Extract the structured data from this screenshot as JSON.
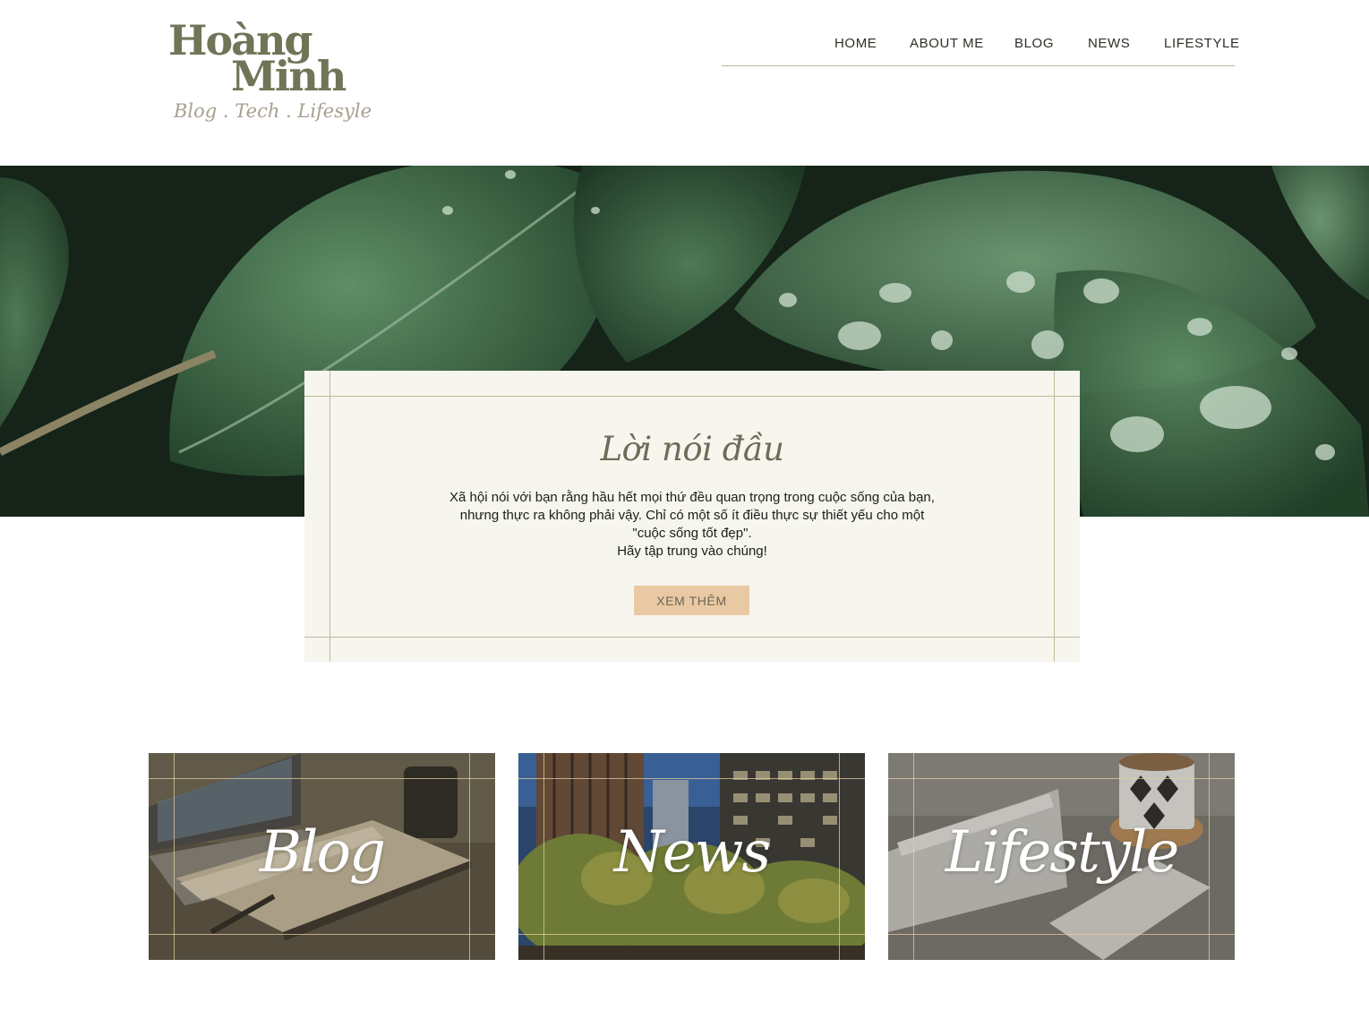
{
  "header": {
    "logo": {
      "line1": "Hoàng",
      "line2": "Minh",
      "tagline": "Blog . Tech . Lifesyle"
    },
    "nav": [
      {
        "label": "HOME"
      },
      {
        "label": "ABOUT ME"
      },
      {
        "label": "BLOG"
      },
      {
        "label": "NEWS"
      },
      {
        "label": "LIFESTYLE"
      }
    ]
  },
  "hero": {
    "image": "green-leaves-with-water-drops"
  },
  "intro": {
    "title": "Lời nói đầu",
    "lines": [
      "Xã hội nói với bạn rằng hầu hết mọi thứ đều quan trọng trong cuộc sống của bạn,",
      "nhưng thực ra không phải vậy. Chỉ có một số ít điều thực sự thiết yếu cho một",
      "\"cuộc sống tốt đẹp\".",
      "Hãy tập trung vào chúng!"
    ],
    "button_label": "XEM THÊM"
  },
  "categories": [
    {
      "label": "Blog",
      "image": "open-notebook-laptop-mug"
    },
    {
      "label": "News",
      "image": "city-office-buildings-trees"
    },
    {
      "label": "Lifestyle",
      "image": "coffee-cup-magazine-phone"
    }
  ],
  "colors": {
    "brand_olive": "#727457",
    "tagline": "#a89f8d",
    "card_bg": "#f6f5ee",
    "guide_line": "#c2b89c",
    "button_bg": "#e9c9a3"
  }
}
